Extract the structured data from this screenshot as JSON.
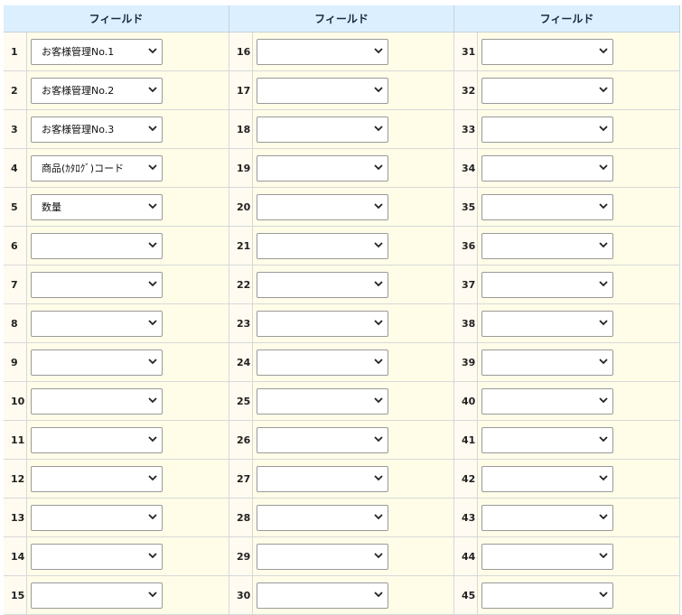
{
  "header": {
    "col1": "フィールド",
    "col2": "フィールド",
    "col3": "フィールド"
  },
  "rows": [
    {
      "n": [
        "1",
        "16",
        "31"
      ],
      "v": [
        "お客様管理No.1",
        "",
        ""
      ]
    },
    {
      "n": [
        "2",
        "17",
        "32"
      ],
      "v": [
        "お客様管理No.2",
        "",
        ""
      ]
    },
    {
      "n": [
        "3",
        "18",
        "33"
      ],
      "v": [
        "お客様管理No.3",
        "",
        ""
      ]
    },
    {
      "n": [
        "4",
        "19",
        "34"
      ],
      "v": [
        "商品(ｶﾀﾛｸﾞ)コード",
        "",
        ""
      ]
    },
    {
      "n": [
        "5",
        "20",
        "35"
      ],
      "v": [
        "数量",
        "",
        ""
      ]
    },
    {
      "n": [
        "6",
        "21",
        "36"
      ],
      "v": [
        "",
        "",
        ""
      ]
    },
    {
      "n": [
        "7",
        "22",
        "37"
      ],
      "v": [
        "",
        "",
        ""
      ]
    },
    {
      "n": [
        "8",
        "23",
        "38"
      ],
      "v": [
        "",
        "",
        ""
      ]
    },
    {
      "n": [
        "9",
        "24",
        "39"
      ],
      "v": [
        "",
        "",
        ""
      ]
    },
    {
      "n": [
        "10",
        "25",
        "40"
      ],
      "v": [
        "",
        "",
        ""
      ]
    },
    {
      "n": [
        "11",
        "26",
        "41"
      ],
      "v": [
        "",
        "",
        ""
      ]
    },
    {
      "n": [
        "12",
        "27",
        "42"
      ],
      "v": [
        "",
        "",
        ""
      ]
    },
    {
      "n": [
        "13",
        "28",
        "43"
      ],
      "v": [
        "",
        "",
        ""
      ]
    },
    {
      "n": [
        "14",
        "29",
        "44"
      ],
      "v": [
        "",
        "",
        ""
      ]
    },
    {
      "n": [
        "15",
        "30",
        "45"
      ],
      "v": [
        "",
        "",
        ""
      ]
    }
  ],
  "icons": {
    "dropdown": "chevron-down-icon"
  }
}
